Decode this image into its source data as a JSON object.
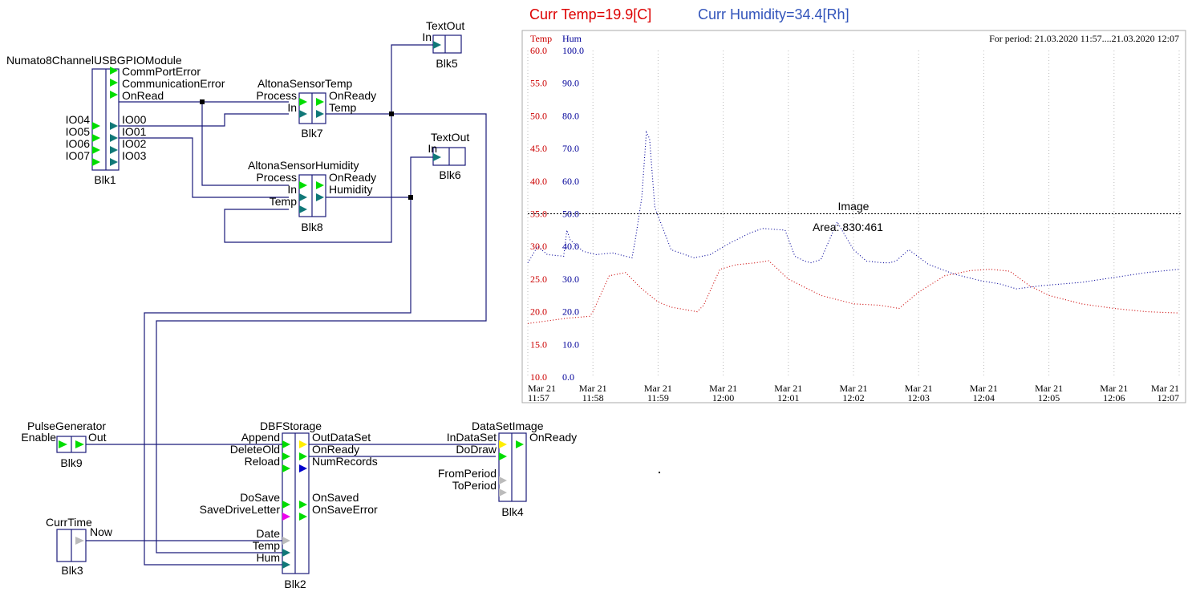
{
  "colors": {
    "wire": "#1a1a7a",
    "pin_green": "#00dd00",
    "pin_teal": "#107878",
    "pin_yellow": "#ffee00",
    "pin_blue": "#0000cc",
    "pin_magenta": "#ee00ee",
    "pin_gray": "#bbbbbb",
    "temp": "#cc0000",
    "hum": "#000099",
    "header_temp": "#dd0000",
    "header_hum": "#3355bb"
  },
  "blocks": {
    "blk1": {
      "title": "Numato8ChannelUSBGPIOModule",
      "id": "Blk1",
      "inputs": [
        "IO04",
        "IO05",
        "IO06",
        "IO07"
      ],
      "outputs": [
        "CommPortError",
        "CommunicationError",
        "OnRead",
        "IO00",
        "IO01",
        "IO02",
        "IO03"
      ]
    },
    "blk5": {
      "title": "TextOut",
      "id": "Blk5",
      "inputs": [
        "In"
      ]
    },
    "blk7": {
      "title": "AltonaSensorTemp",
      "id": "Blk7",
      "inputs": [
        "Process",
        "In"
      ],
      "outputs": [
        "OnReady",
        "Temp"
      ]
    },
    "blk6": {
      "title": "TextOut",
      "id": "Blk6",
      "inputs": [
        "In"
      ]
    },
    "blk8": {
      "title": "AltonaSensorHumidity",
      "id": "Blk8",
      "inputs": [
        "Process",
        "In",
        "Temp"
      ],
      "outputs": [
        "OnReady",
        "Humidity"
      ]
    },
    "blk9": {
      "title": "PulseGenerator",
      "id": "Blk9",
      "inputs": [
        "Enable"
      ],
      "outputs": [
        "Out"
      ]
    },
    "blk2": {
      "title": "DBFStorage",
      "id": "Blk2",
      "inputs": [
        "Append",
        "DeleteOld",
        "Reload",
        "DoSave",
        "SaveDriveLetter",
        "Date",
        "Temp",
        "Hum"
      ],
      "outputs": [
        "OutDataSet",
        "OnReady",
        "NumRecords",
        "OnSaved",
        "OnSaveError"
      ]
    },
    "blk4": {
      "title": "DataSetImage",
      "id": "Blk4",
      "inputs": [
        "InDataSet",
        "DoDraw",
        "FromPeriod",
        "ToPeriod"
      ],
      "outputs": [
        "OnReady"
      ]
    },
    "blk3": {
      "title": "CurrTime",
      "id": "Blk3",
      "outputs": [
        "Now"
      ]
    }
  },
  "header": {
    "temp": "Curr Temp=19.9[C]",
    "hum": "Curr Humidity=34.4[Rh]"
  },
  "overlay": {
    "image_label": "Image",
    "area_label": "Area: 830:461"
  },
  "chart_data": {
    "type": "line",
    "legend": [
      "Temp",
      "Hum"
    ],
    "period": "For period: 21.03.2020 11:57....21.03.2020 12:07",
    "temp_ticks": [
      "60.0",
      "55.0",
      "50.0",
      "45.0",
      "40.0",
      "35.0",
      "30.0",
      "25.0",
      "20.0",
      "15.0",
      "10.0"
    ],
    "hum_ticks": [
      "100.0",
      "90.0",
      "80.0",
      "70.0",
      "60.0",
      "50.0",
      "40.0",
      "30.0",
      "20.0",
      "10.0",
      "0.0"
    ],
    "ylim_temp": [
      10,
      60
    ],
    "ylim_hum": [
      0,
      100
    ],
    "xlim": [
      0,
      10
    ],
    "x_ticks": [
      {
        "t": 0,
        "d": "Mar 21",
        "h": "11:57"
      },
      {
        "t": 1,
        "d": "Mar 21",
        "h": "11:58"
      },
      {
        "t": 2,
        "d": "Mar 21",
        "h": "11:59"
      },
      {
        "t": 3,
        "d": "Mar 21",
        "h": "12:00"
      },
      {
        "t": 4,
        "d": "Mar 21",
        "h": "12:01"
      },
      {
        "t": 5,
        "d": "Mar 21",
        "h": "12:02"
      },
      {
        "t": 6,
        "d": "Mar 21",
        "h": "12:03"
      },
      {
        "t": 7,
        "d": "Mar 21",
        "h": "12:04"
      },
      {
        "t": 8,
        "d": "Mar 21",
        "h": "12:05"
      },
      {
        "t": 9,
        "d": "Mar 21",
        "h": "12:06"
      },
      {
        "t": 10,
        "d": "Mar 21",
        "h": "12:07"
      }
    ],
    "reference_temp": 35,
    "series": [
      {
        "name": "Temp",
        "x": [
          0,
          0.3,
          0.6,
          0.95,
          1.0,
          1.25,
          1.5,
          1.75,
          2.0,
          2.2,
          2.6,
          2.7,
          2.95,
          3.2,
          3.5,
          3.7,
          4.0,
          4.5,
          5.0,
          5.4,
          5.7,
          6.0,
          6.4,
          6.8,
          7.1,
          7.4,
          7.7,
          8.0,
          8.5,
          9.0,
          9.5,
          10.0
        ],
        "values": [
          18.2,
          18.6,
          19.0,
          19.3,
          20.0,
          25.5,
          26.0,
          23.5,
          21.5,
          20.7,
          20.0,
          21.0,
          26.5,
          27.2,
          27.5,
          27.8,
          25.0,
          22.5,
          21.2,
          21.0,
          20.5,
          23.0,
          25.5,
          26.3,
          26.5,
          26.2,
          24.0,
          22.5,
          21.2,
          20.5,
          20.0,
          19.8
        ]
      },
      {
        "name": "Hum",
        "x": [
          0,
          0.15,
          0.3,
          0.55,
          0.6,
          0.65,
          0.85,
          1.05,
          1.3,
          1.6,
          1.65,
          1.75,
          1.82,
          1.87,
          1.95,
          2.2,
          2.55,
          2.8,
          3.1,
          3.4,
          3.6,
          3.95,
          4.1,
          4.25,
          4.35,
          4.5,
          4.75,
          5.0,
          5.2,
          5.45,
          5.55,
          5.65,
          5.85,
          6.15,
          6.55,
          6.95,
          7.25,
          7.5,
          7.9,
          8.5,
          9.0,
          9.5,
          10.0
        ],
        "values": [
          35.0,
          40.0,
          37.5,
          37.0,
          45.0,
          42.0,
          38.5,
          37.5,
          38.0,
          36.5,
          42.0,
          55.0,
          75.0,
          73.0,
          52.0,
          39.0,
          36.5,
          37.5,
          41.0,
          44.0,
          45.5,
          45.0,
          37.0,
          35.5,
          35.0,
          36.0,
          47.5,
          39.0,
          35.5,
          35.0,
          35.0,
          35.5,
          39.0,
          34.5,
          31.5,
          29.5,
          28.5,
          27.0,
          28.0,
          29.0,
          30.5,
          32.0,
          33.0
        ]
      }
    ]
  }
}
